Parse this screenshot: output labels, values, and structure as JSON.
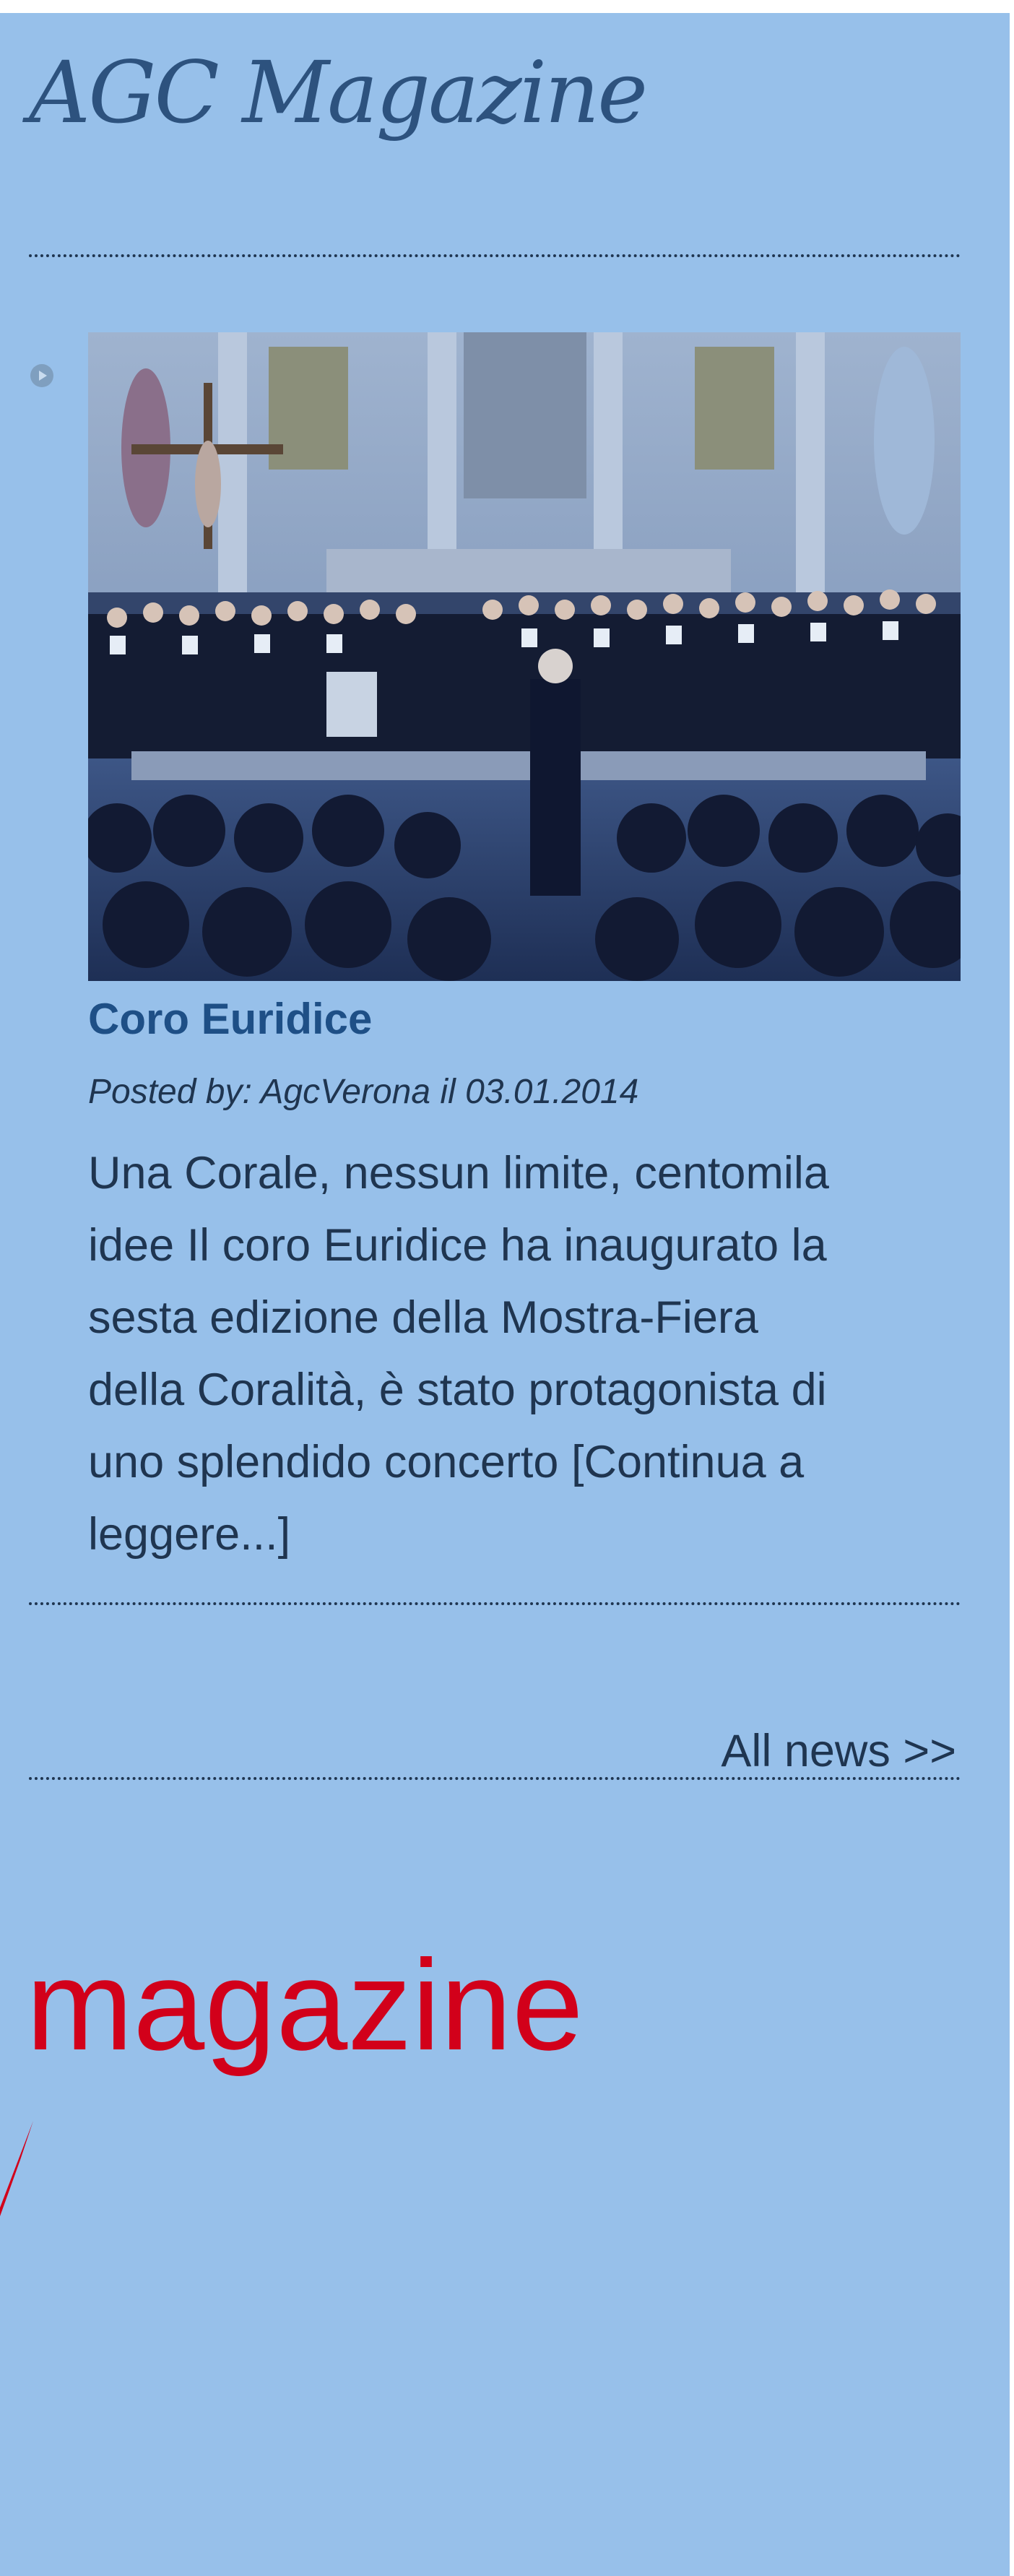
{
  "widget": {
    "title": "AGC Magazine"
  },
  "news_item": {
    "image_alt": "Coro Euridice concert in church",
    "title": "Coro Euridice",
    "meta": "Posted by: AgcVerona il 03.01.2014",
    "excerpt_lines": [
      "Una Corale, nessun limite, centomila",
      "idee Il coro Euridice ha inaugurato la",
      "sesta edizione della Mostra-Fiera",
      "della Coralità, è stato protagonista di",
      "uno splendido concerto "
    ],
    "read_more_part1": "[Continua a",
    "read_more_part2": "leggere...]"
  },
  "all_news_link": "All news >>",
  "banner": {
    "word": "magazine"
  },
  "colors": {
    "panel_bg": "#97c0ea",
    "title_text": "#2d527e",
    "body_text": "#1f3550",
    "news_title": "#1e4f86",
    "banner_red": "#d2001a"
  },
  "icons": {
    "bullet": "play-bullet-icon"
  }
}
